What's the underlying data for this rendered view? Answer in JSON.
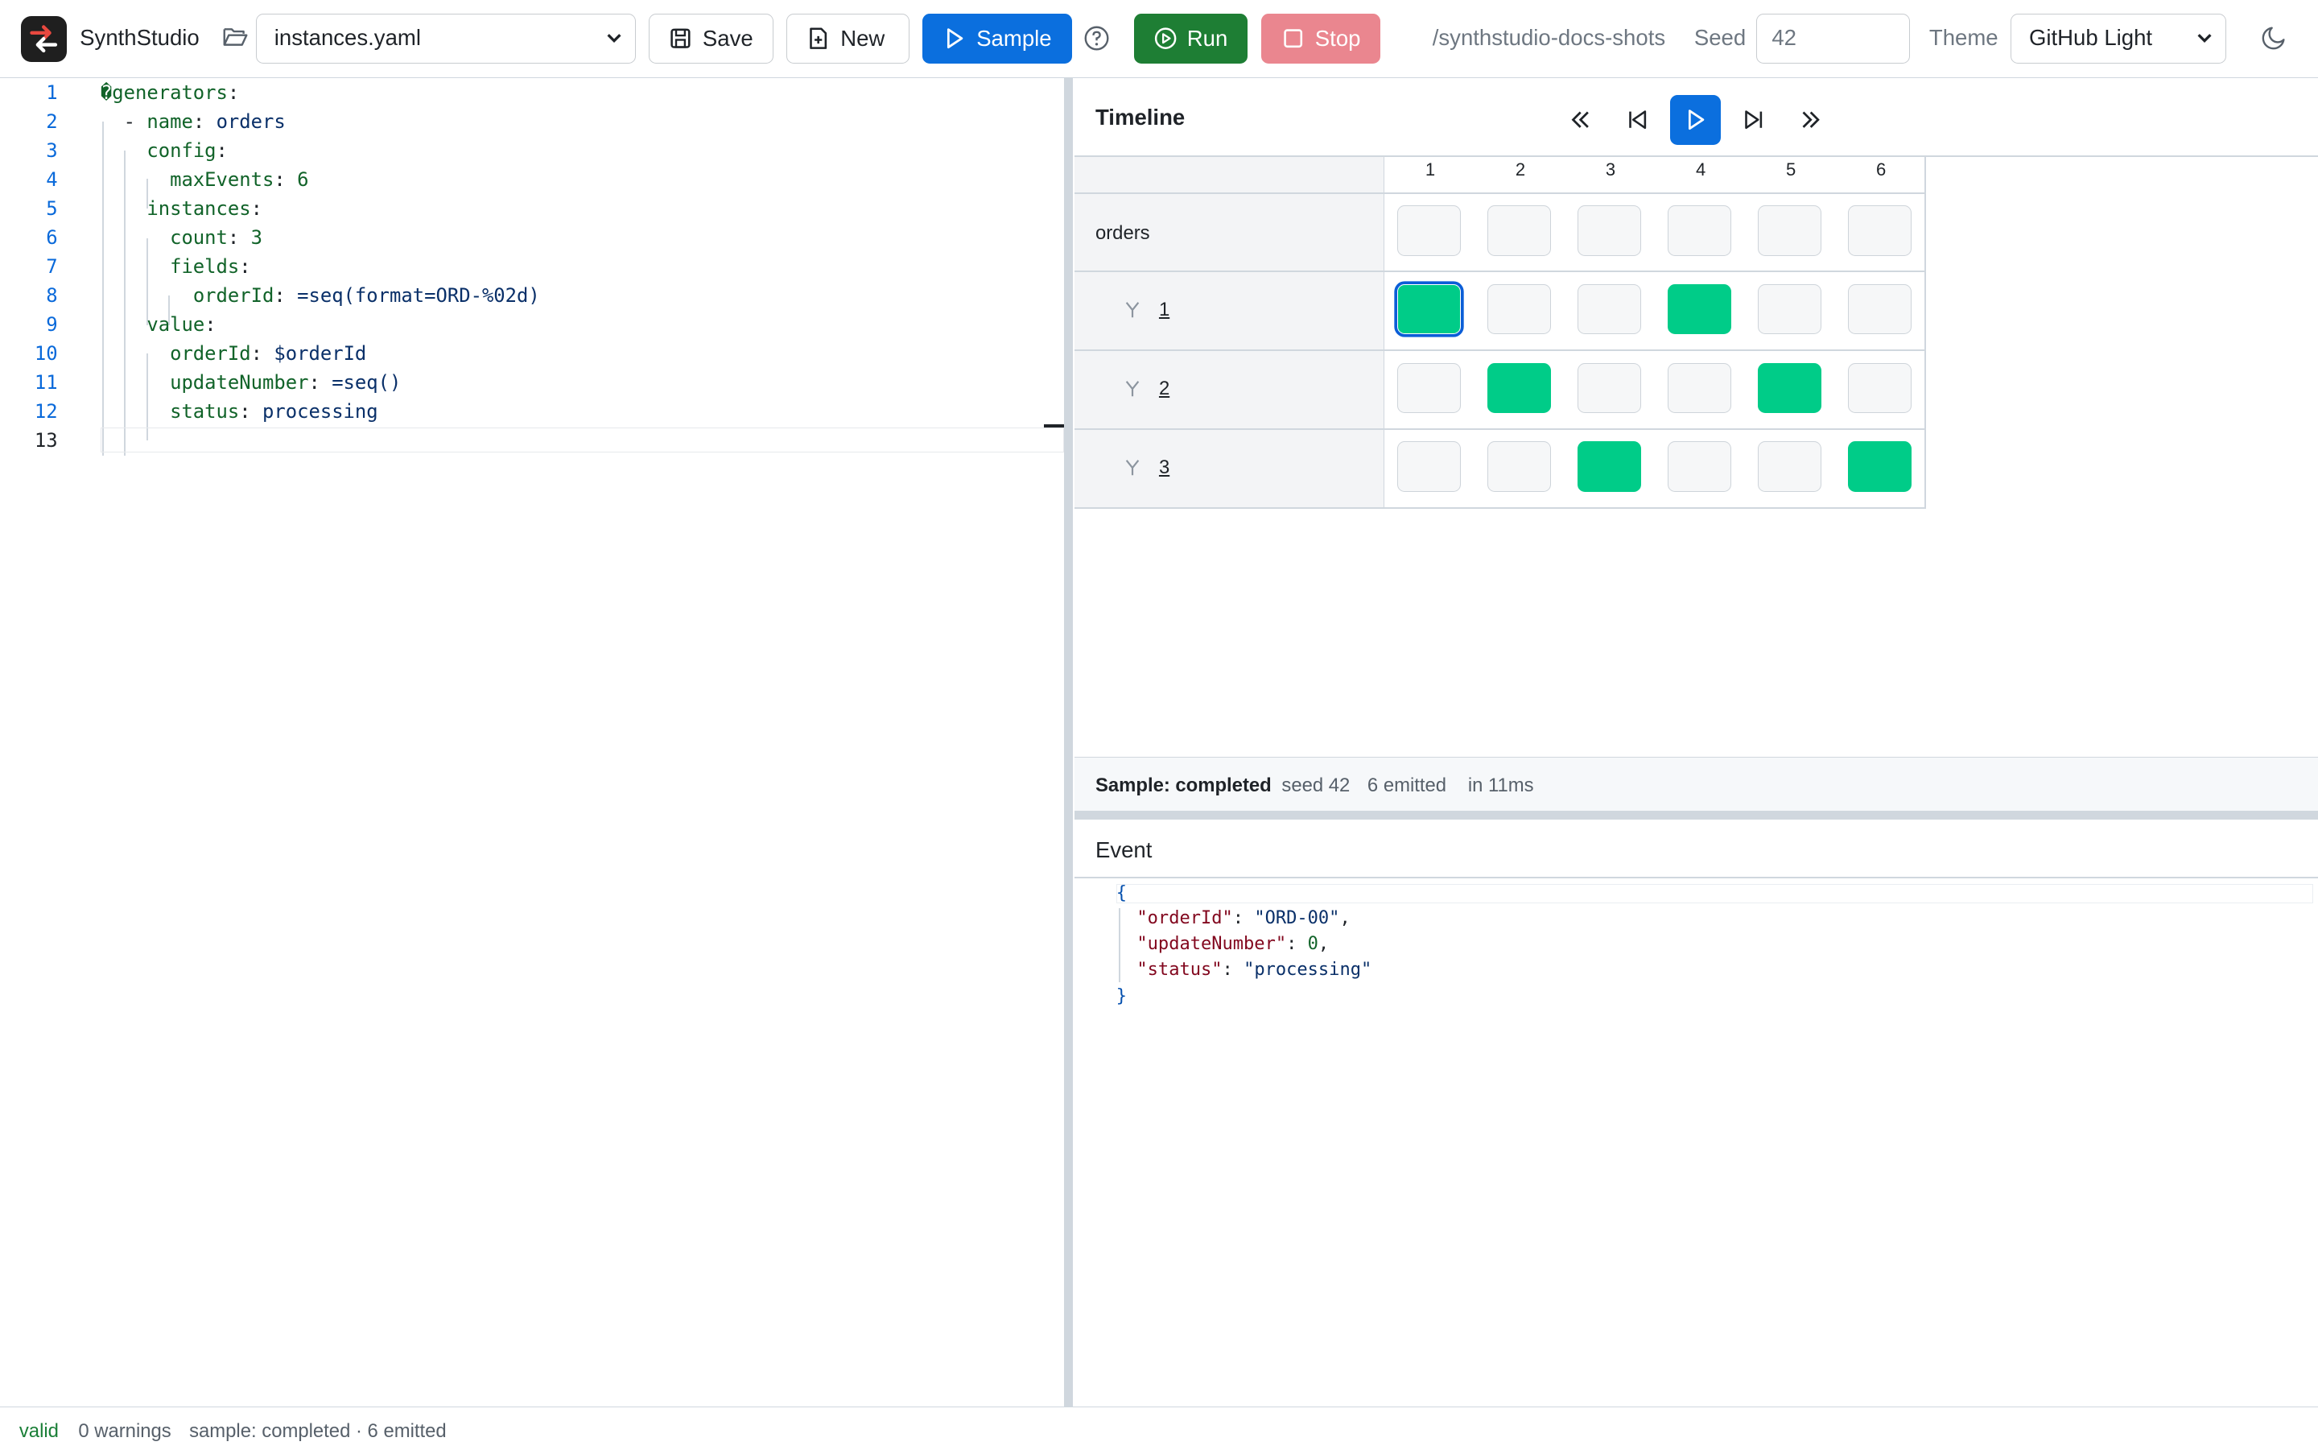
{
  "app": {
    "title": "SynthStudio"
  },
  "toolbar": {
    "file": "instances.yaml",
    "save_label": "Save",
    "new_label": "New",
    "sample_label": "Sample",
    "run_label": "Run",
    "stop_label": "Stop",
    "path": "/synthstudio-docs-shots",
    "seed_label": "Seed",
    "seed_value": "42",
    "theme_label": "Theme",
    "theme_value": "GitHub Light"
  },
  "editor": {
    "lines": [
      "�generators:",
      "  - name: orders",
      "    config:",
      "      maxEvents: 6",
      "    instances:",
      "      count: 3",
      "      fields:",
      "        orderId: =seq(format=ORD-%02d)",
      "    value:",
      "      orderId: $orderId",
      "      updateNumber: =seq()",
      "      status: processing",
      ""
    ]
  },
  "timeline": {
    "title": "Timeline",
    "columns": [
      "1",
      "2",
      "3",
      "4",
      "5",
      "6"
    ],
    "generator": "orders",
    "instances": [
      {
        "label": "1",
        "events": [
          1,
          0,
          0,
          1,
          0,
          0
        ]
      },
      {
        "label": "2",
        "events": [
          0,
          1,
          0,
          0,
          1,
          0
        ]
      },
      {
        "label": "3",
        "events": [
          0,
          0,
          1,
          0,
          0,
          1
        ]
      }
    ],
    "status": {
      "text": "Sample: completed",
      "seed": "seed 42",
      "emitted": "6 emitted",
      "duration": "in 11ms"
    }
  },
  "event": {
    "title": "Event",
    "open_brace": "{",
    "close_brace": "}",
    "fields": [
      {
        "key": "\"orderId\"",
        "value": "\"ORD-00\"",
        "type": "string",
        "comma": ","
      },
      {
        "key": "\"updateNumber\"",
        "value": "0",
        "type": "number",
        "comma": ","
      },
      {
        "key": "\"status\"",
        "value": "\"processing\"",
        "type": "string",
        "comma": ""
      }
    ]
  },
  "footer": {
    "valid": "valid",
    "warnings": "0 warnings",
    "summary": "sample: completed · 6 emitted"
  },
  "colors": {
    "primary": "#0b6fde",
    "success": "#1e7e34",
    "danger": "#ea868f",
    "event_on": "#00cc88"
  }
}
